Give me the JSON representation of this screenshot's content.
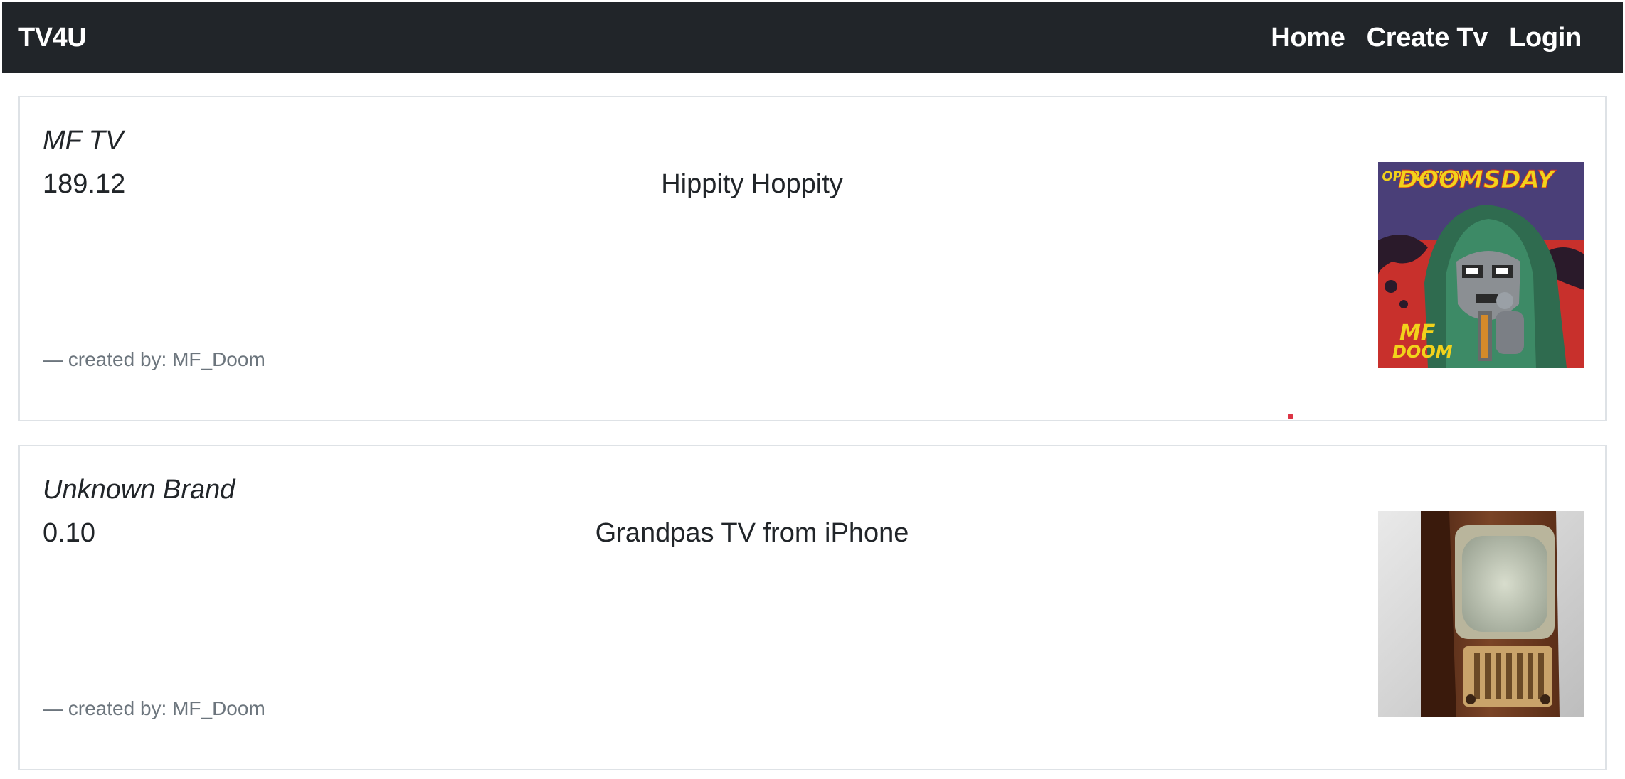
{
  "navbar": {
    "brand": "TV4U",
    "links": [
      {
        "label": "Home"
      },
      {
        "label": "Create Tv"
      },
      {
        "label": "Login"
      }
    ]
  },
  "cards": [
    {
      "brand": "MF TV",
      "price": "189.12",
      "title": "Hippity Hoppity",
      "footer": "— created by: MF_Doom",
      "image": "album-cover-operation-doomsday"
    },
    {
      "brand": "Unknown Brand",
      "price": "0.10",
      "title": "Grandpas TV from iPhone",
      "footer": "— created by: MF_Doom",
      "image": "vintage-wooden-television"
    }
  ],
  "colors": {
    "navbar_bg": "#212529",
    "muted_text": "#6c757d",
    "card_border": "#dee2e6"
  }
}
